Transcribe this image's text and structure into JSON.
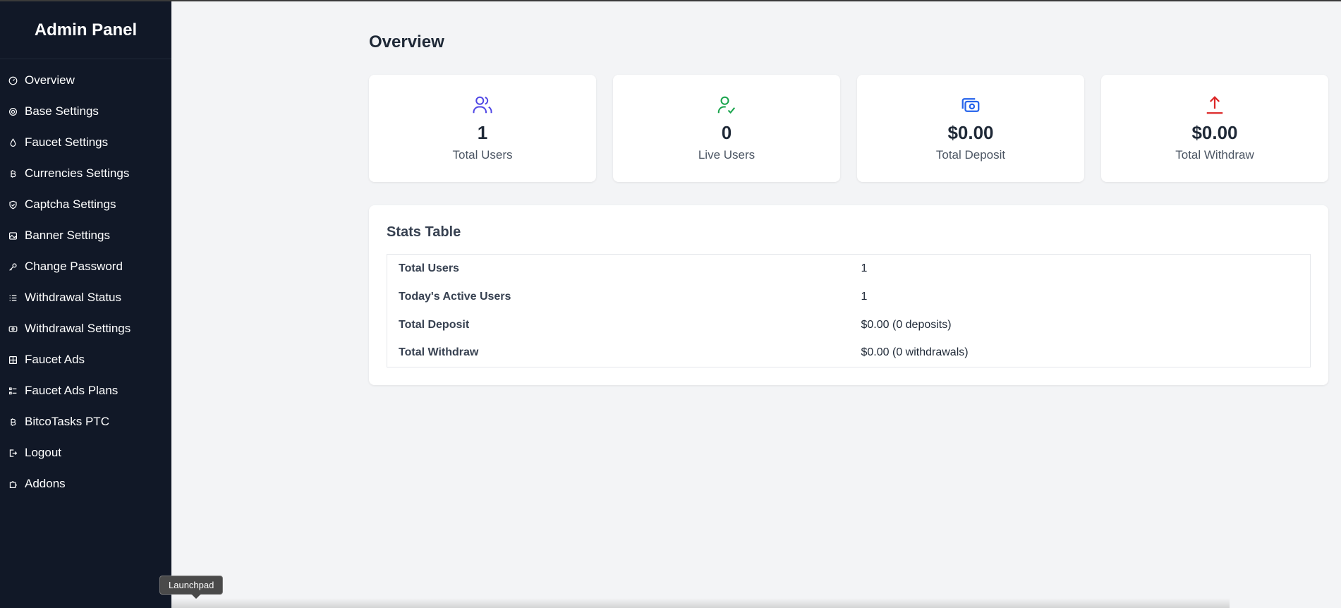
{
  "brand": "Admin Panel",
  "sidebar": {
    "items": [
      {
        "label": "Overview",
        "icon": "gauge-icon"
      },
      {
        "label": "Base Settings",
        "icon": "gear-icon"
      },
      {
        "label": "Faucet Settings",
        "icon": "droplet-icon"
      },
      {
        "label": "Currencies Settings",
        "icon": "bitcoin-icon"
      },
      {
        "label": "Captcha Settings",
        "icon": "shield-icon"
      },
      {
        "label": "Banner Settings",
        "icon": "image-icon"
      },
      {
        "label": "Change Password",
        "icon": "key-icon"
      },
      {
        "label": "Withdrawal Status",
        "icon": "list-icon"
      },
      {
        "label": "Withdrawal Settings",
        "icon": "money-icon"
      },
      {
        "label": "Faucet Ads",
        "icon": "grid-icon"
      },
      {
        "label": "Faucet Ads Plans",
        "icon": "list-check-icon"
      },
      {
        "label": "BitcoTasks PTC",
        "icon": "bitcoin-icon"
      },
      {
        "label": "Logout",
        "icon": "logout-icon"
      },
      {
        "label": "Addons",
        "icon": "puzzle-icon"
      }
    ]
  },
  "main": {
    "title": "Overview",
    "cards": [
      {
        "value": "1",
        "label": "Total Users",
        "icon": "users-icon",
        "color": "#4f46e5"
      },
      {
        "value": "0",
        "label": "Live Users",
        "icon": "user-check-icon",
        "color": "#16a34a"
      },
      {
        "value": "$0.00",
        "label": "Total Deposit",
        "icon": "cash-icon",
        "color": "#2563eb"
      },
      {
        "value": "$0.00",
        "label": "Total Withdraw",
        "icon": "upload-icon",
        "color": "#dc2626"
      }
    ],
    "stats": {
      "title": "Stats Table",
      "rows": [
        {
          "key": "Total Users",
          "value": "1"
        },
        {
          "key": "Today's Active Users",
          "value": "1"
        },
        {
          "key": "Total Deposit",
          "value": "$0.00 (0 deposits)"
        },
        {
          "key": "Total Withdraw",
          "value": "$0.00 (0 withdrawals)"
        }
      ]
    }
  },
  "tooltip": "Launchpad"
}
